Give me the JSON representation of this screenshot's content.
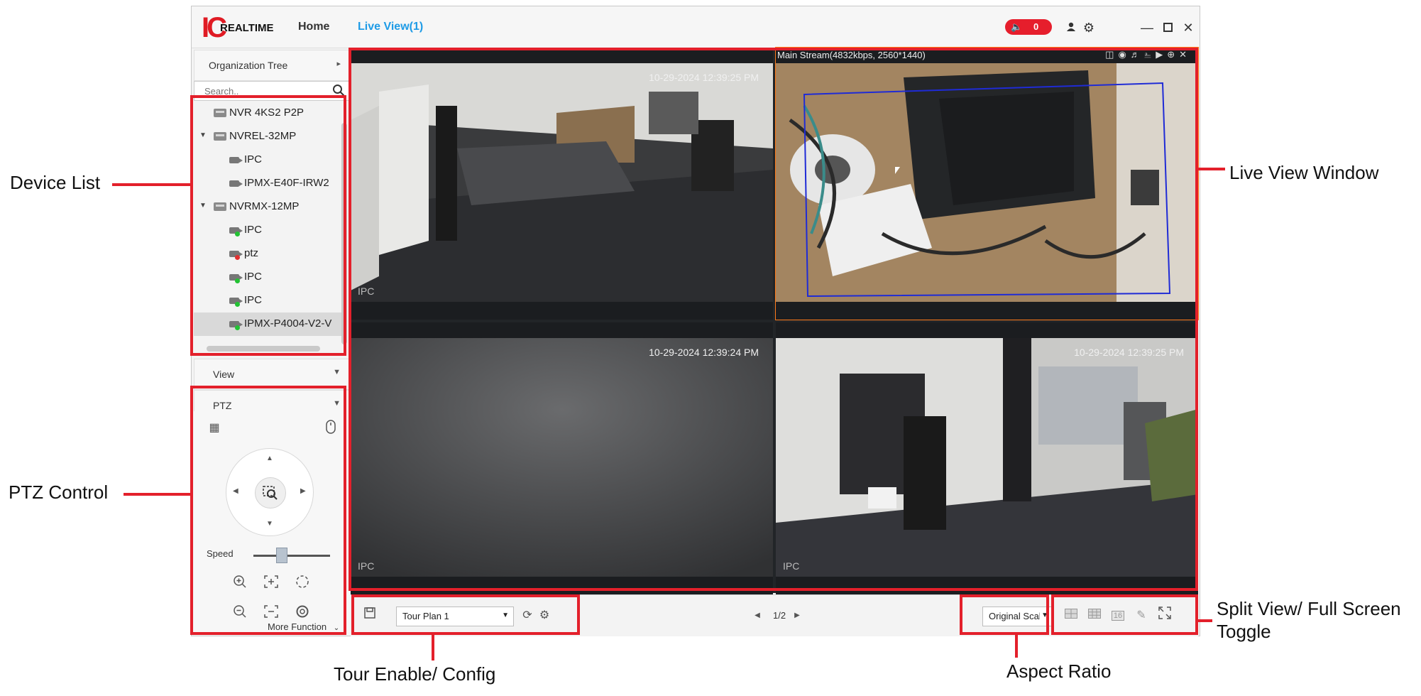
{
  "header": {
    "logo_ic": "IC",
    "logo_text": "REALTIME",
    "nav_home": "Home",
    "nav_live": "Live View(1)",
    "alarm_count": "0",
    "icons": [
      "alarm-speaker-icon",
      "user-icon",
      "settings-gear-icon",
      "minimize-icon",
      "maximize-icon",
      "close-icon"
    ]
  },
  "sidebar": {
    "org_tree_label": "Organization Tree",
    "search_placeholder": "Search..",
    "tree": [
      {
        "label": "NVR 4KS2 P2P",
        "kind": "nvr",
        "expanded": null,
        "status": null
      },
      {
        "label": "NVREL-32MP",
        "kind": "nvr",
        "expanded": true,
        "status": null
      },
      {
        "label": "IPC",
        "kind": "camera",
        "status": null
      },
      {
        "label": "IPMX-E40F-IRW2",
        "kind": "camera",
        "status": null
      },
      {
        "label": "NVRMX-12MP",
        "kind": "nvr",
        "expanded": true,
        "status": null
      },
      {
        "label": "IPC",
        "kind": "camera",
        "status": "online"
      },
      {
        "label": "ptz",
        "kind": "camera",
        "status": "offline"
      },
      {
        "label": "IPC",
        "kind": "camera",
        "status": "online"
      },
      {
        "label": "IPC",
        "kind": "camera",
        "status": "online"
      },
      {
        "label": "IPMX-P4004-V2-V",
        "kind": "camera",
        "status": "online",
        "selected": true
      }
    ],
    "view_label": "View",
    "ptz_label": "PTZ",
    "speed_label": "Speed",
    "more_function_label": "More Function",
    "speed_value": 0.35
  },
  "live_view": {
    "tiles": [
      {
        "timestamp": "10-29-2024 12:39:25 PM",
        "camera": "IPC",
        "stream": "",
        "scene": "office"
      },
      {
        "timestamp": "",
        "camera": "",
        "stream": "Main Stream(4832kbps, 2560*1440)",
        "scene": "desk"
      },
      {
        "timestamp": "10-29-2024 12:39:24 PM",
        "camera": "IPC",
        "stream": "",
        "scene": "gray"
      },
      {
        "timestamp": "10-29-2024 12:39:25 PM",
        "camera": "IPC",
        "stream": "",
        "scene": "office2"
      }
    ]
  },
  "bottom_bar": {
    "tour_plan": "Tour Plan 1",
    "page_indicator": "1/2",
    "aspect_ratio": "Original Scale",
    "split_16_label": "16"
  },
  "annotations": {
    "device_list": "Device List",
    "ptz_control": "PTZ Control",
    "live_view_window": "Live View Window",
    "split_view_line1": "Split View/ Full Screen",
    "split_view_line2": "Toggle",
    "tour_enable": "Tour Enable/ Config",
    "aspect_ratio": "Aspect Ratio"
  },
  "colors": {
    "annotation_red": "#e3202b",
    "accent_blue": "#1e9be6",
    "brand_red": "#e01b24",
    "online_green": "#22c233",
    "offline_red": "#e03030"
  }
}
